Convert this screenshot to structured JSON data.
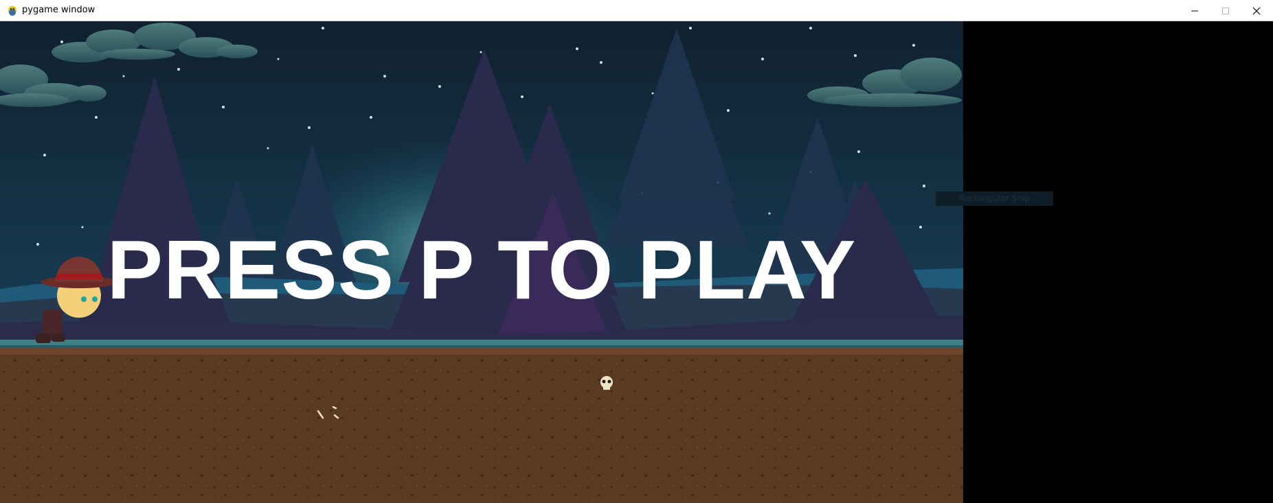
{
  "window": {
    "title": "pygame window",
    "icon": "pygame-snake-icon",
    "controls": [
      "minimize-icon",
      "maximize-icon",
      "close-icon"
    ]
  },
  "game": {
    "prompt": "PRESS P TO PLAY",
    "overlay_label": "Rectangular Snip",
    "player": "cowboy-character",
    "props": [
      "skull-icon",
      "bone-icon",
      "bone-icon"
    ]
  },
  "colors": {
    "sky_top": "#0f2233",
    "sky_bottom": "#1d4a63",
    "ground": "#5a3a22",
    "grass": "#3f7f86",
    "text": "#ffffff"
  }
}
